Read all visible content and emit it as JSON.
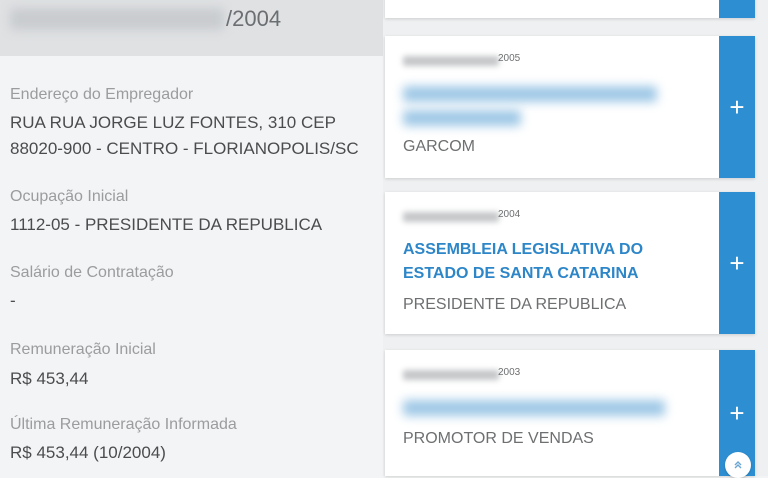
{
  "left": {
    "period_year": "/2004",
    "fields": [
      {
        "label": "Endereço do Empregador",
        "value_line1": "RUA RUA JORGE LUZ FONTES, 310 CEP",
        "value_line2": "88020-900 - CENTRO - FLORIANOPOLIS/SC"
      },
      {
        "label": "Ocupação Inicial",
        "value": "1112-05 - PRESIDENTE DA REPUBLICA"
      },
      {
        "label": "Salário de Contratação",
        "value": "-"
      },
      {
        "label": "Remuneração Inicial",
        "value": "R$ 453,44"
      },
      {
        "label": "Última Remuneração Informada",
        "value": "R$ 453,44 (10/2004)"
      }
    ]
  },
  "cards": [
    {
      "year": "2005",
      "company": "",
      "occupation": "GARCOM",
      "action": "+"
    },
    {
      "year": "2004",
      "company": "ASSEMBLEIA LEGISLATIVA DO ESTADO DE SANTA CATARINA",
      "occupation": "PRESIDENTE DA REPUBLICA",
      "action": "+"
    },
    {
      "year": "2003",
      "company": "",
      "occupation": "PROMOTOR DE VENDAS",
      "action": "+"
    }
  ],
  "scroll_top_icon": "chevron-double-up-icon",
  "colors": {
    "accent": "#2d8fd1",
    "company_text": "#2d86c8"
  }
}
